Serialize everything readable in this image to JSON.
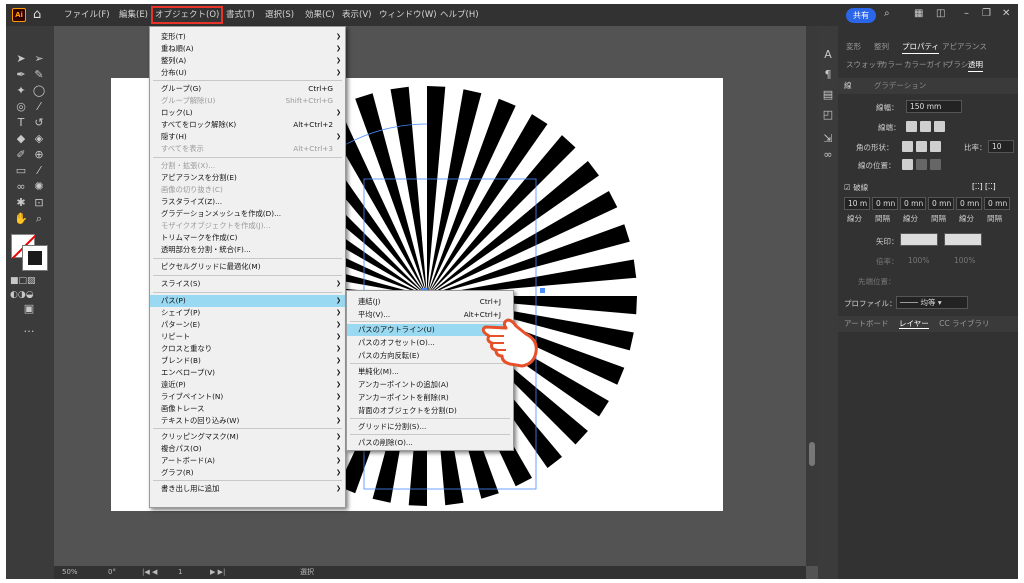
{
  "menubar": {
    "items": [
      {
        "label": "ファイル(F)"
      },
      {
        "label": "編集(E)"
      },
      {
        "label": "オブジェクト(O)"
      },
      {
        "label": "書式(T)"
      },
      {
        "label": "選択(S)"
      },
      {
        "label": "効果(C)"
      },
      {
        "label": "表示(V)"
      },
      {
        "label": "ウィンドウ(W)"
      },
      {
        "label": "ヘルプ(H)"
      }
    ],
    "share": "共有",
    "app_logo": "Ai",
    "highlight_color": "#e8332a"
  },
  "object_menu": {
    "items": [
      {
        "label": "変形(T)",
        "shortcut": "",
        "submenu": true
      },
      {
        "label": "重ね順(A)",
        "shortcut": "",
        "submenu": true
      },
      {
        "label": "整列(A)",
        "shortcut": "",
        "submenu": true
      },
      {
        "label": "分布(U)",
        "shortcut": "",
        "submenu": true
      },
      {
        "label": "グループ(G)",
        "shortcut": "Ctrl+G",
        "submenu": false
      },
      {
        "label": "グループ解除(U)",
        "shortcut": "Shift+Ctrl+G",
        "submenu": false,
        "disabled": true
      },
      {
        "label": "ロック(L)",
        "shortcut": "",
        "submenu": true
      },
      {
        "label": "すべてをロック解除(K)",
        "shortcut": "Alt+Ctrl+2",
        "submenu": false
      },
      {
        "label": "隠す(H)",
        "shortcut": "",
        "submenu": true
      },
      {
        "label": "すべてを表示",
        "shortcut": "Alt+Ctrl+3",
        "submenu": false,
        "disabled": true
      },
      {
        "label": "分割・拡張(X)...",
        "shortcut": "",
        "submenu": false,
        "disabled": true
      },
      {
        "label": "アピアランスを分割(E)",
        "shortcut": "",
        "submenu": false
      },
      {
        "label": "画像の切り抜き(C)",
        "shortcut": "",
        "submenu": false,
        "disabled": true
      },
      {
        "label": "ラスタライズ(Z)...",
        "shortcut": "",
        "submenu": false
      },
      {
        "label": "グラデーションメッシュを作成(D)...",
        "shortcut": "",
        "submenu": false
      },
      {
        "label": "モザイクオブジェクトを作成(J)...",
        "shortcut": "",
        "submenu": false,
        "disabled": true
      },
      {
        "label": "トリムマークを作成(C)",
        "shortcut": "",
        "submenu": false
      },
      {
        "label": "透明部分を分割・統合(F)...",
        "shortcut": "",
        "submenu": false
      },
      {
        "label": "ピクセルグリッドに最適化(M)",
        "shortcut": "",
        "submenu": false
      },
      {
        "label": "スライス(S)",
        "shortcut": "",
        "submenu": true
      },
      {
        "label": "パス(P)",
        "shortcut": "",
        "submenu": true,
        "highlighted": true
      },
      {
        "label": "シェイプ(P)",
        "shortcut": "",
        "submenu": true
      },
      {
        "label": "パターン(E)",
        "shortcut": "",
        "submenu": true
      },
      {
        "label": "リピート",
        "shortcut": "",
        "submenu": true
      },
      {
        "label": "クロスと重なり",
        "shortcut": "",
        "submenu": true
      },
      {
        "label": "ブレンド(B)",
        "shortcut": "",
        "submenu": true
      },
      {
        "label": "エンベロープ(V)",
        "shortcut": "",
        "submenu": true
      },
      {
        "label": "遠近(P)",
        "shortcut": "",
        "submenu": true
      },
      {
        "label": "ライブペイント(N)",
        "shortcut": "",
        "submenu": true
      },
      {
        "label": "画像トレース",
        "shortcut": "",
        "submenu": true
      },
      {
        "label": "テキストの回り込み(W)",
        "shortcut": "",
        "submenu": true
      },
      {
        "label": "クリッピングマスク(M)",
        "shortcut": "",
        "submenu": true
      },
      {
        "label": "複合パス(O)",
        "shortcut": "",
        "submenu": true
      },
      {
        "label": "アートボード(A)",
        "shortcut": "",
        "submenu": true
      },
      {
        "label": "グラフ(R)",
        "shortcut": "",
        "submenu": true
      },
      {
        "label": "書き出し用に追加",
        "shortcut": "",
        "submenu": true
      }
    ]
  },
  "path_submenu": {
    "items": [
      {
        "label": "連結(J)",
        "shortcut": "Ctrl+J"
      },
      {
        "label": "平均(V)...",
        "shortcut": "Alt+Ctrl+J"
      },
      {
        "label": "パスのアウトライン(U)",
        "shortcut": "",
        "highlighted": true
      },
      {
        "label": "パスのオフセット(O)...",
        "shortcut": ""
      },
      {
        "label": "パスの方向反転(E)",
        "shortcut": ""
      },
      {
        "label": "単純化(M)...",
        "shortcut": ""
      },
      {
        "label": "アンカーポイントの追加(A)",
        "shortcut": ""
      },
      {
        "label": "アンカーポイントを削除(R)",
        "shortcut": ""
      },
      {
        "label": "背面のオブジェクトを分割(D)",
        "shortcut": ""
      },
      {
        "label": "グリッドに分割(S)...",
        "shortcut": ""
      },
      {
        "label": "パスの削除(O)...",
        "shortcut": ""
      }
    ]
  },
  "panel": {
    "tabs": [
      "変形",
      "整列",
      "プロパティ",
      "アピアランス"
    ],
    "tabs2": [
      "スウォッチ",
      "カラー",
      "カラーガイド",
      "ブラシ",
      "透明"
    ],
    "section_tabs": [
      "線",
      "グラデーション"
    ],
    "stroke_weight_label": "線幅：",
    "stroke_weight_value": "150 mm",
    "cap_label": "線端：",
    "corner_label": "角の形状：",
    "limit_label": "比率：",
    "limit_value": "10",
    "align_label": "線の位置：",
    "dashed_label": "破線",
    "dash_values": [
      "10 m",
      "0 mn",
      "0 mn",
      "0 mn",
      "0 mn",
      "0 mn"
    ],
    "dash_labels": [
      "線分",
      "間隔",
      "線分",
      "間隔",
      "線分",
      "間隔"
    ],
    "arrow_label": "矢印：",
    "scale_label": "倍率：",
    "scale_values": [
      "100%",
      "100%"
    ],
    "arrow_align_label": "先端位置：",
    "profile_label": "プロファイル：",
    "profile_value": "均等",
    "bottom_tabs": [
      "アートボード",
      "レイヤー",
      "CC ライブラリ"
    ]
  },
  "status": {
    "zoom": "50%",
    "rotate": "0°",
    "artboard": "1",
    "tool": "選択"
  },
  "colors": {
    "highlight": "#99d9f2",
    "accent": "#2c66e8",
    "hand": "#e8502a"
  }
}
